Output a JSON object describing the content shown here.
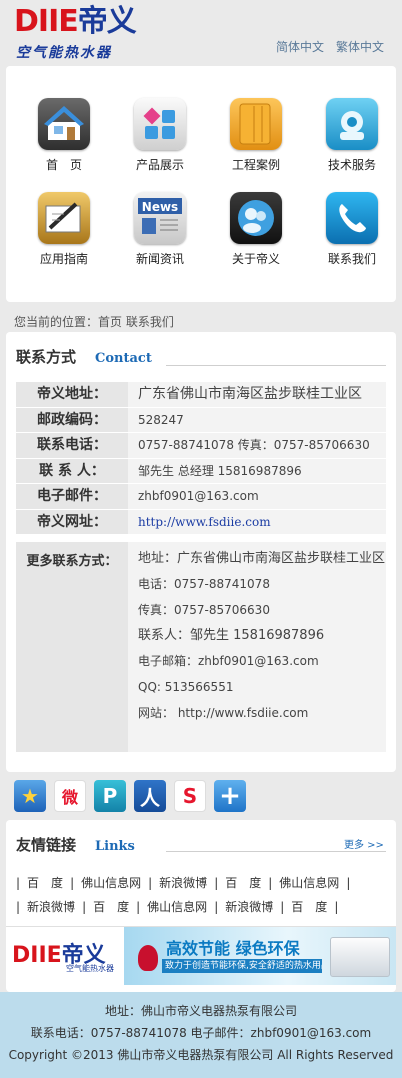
{
  "header": {
    "logo_text_latin": "DIIE",
    "logo_text_cn": "帝义",
    "logo_slogan": "空气能热水器",
    "lang_simplified": "简体中文",
    "lang_traditional": "繁体中文"
  },
  "menu": [
    {
      "label": "首　页",
      "icon": "home-icon"
    },
    {
      "label": "产品展示",
      "icon": "products-icon"
    },
    {
      "label": "工程案例",
      "icon": "folders-icon"
    },
    {
      "label": "技术服务",
      "icon": "service-icon"
    },
    {
      "label": "应用指南",
      "icon": "guide-icon"
    },
    {
      "label": "新闻资讯",
      "icon": "news-icon"
    },
    {
      "label": "关于帝义",
      "icon": "about-icon"
    },
    {
      "label": "联系我们",
      "icon": "phone-icon"
    }
  ],
  "breadcrumb": "您当前的位置：首页  联系我们",
  "contact": {
    "title": "联系方式",
    "title_en": "Contact",
    "rows": [
      {
        "label": "帝义地址：",
        "value": "广东省佛山市南海区盐步联桂工业区"
      },
      {
        "label": "邮政编码：",
        "value": "528247"
      },
      {
        "label": "联系电话：",
        "value": "0757-88741078  传真：0757-85706630"
      },
      {
        "label": "联 系 人：",
        "value": "邹先生 总经理  15816987896"
      },
      {
        "label": "电子邮件：",
        "value": "zhbf0901@163.com"
      },
      {
        "label": "帝义网址：",
        "value": "http://www.fsdiie.com"
      }
    ],
    "more_label": "更多联系方式：",
    "more_lines": [
      "地址：广东省佛山市南海区盐步联桂工业区",
      "电话：0757-88741078",
      "传真：0757-85706630",
      "联系人：邹先生      15816987896",
      "电子邮箱：zhbf0901@163.com",
      "QQ: 513566551",
      "网站：    http://www.fsdiie.com"
    ]
  },
  "share": [
    {
      "icon": "qzone-icon",
      "glyph": "★"
    },
    {
      "icon": "weibo-icon",
      "glyph": "微"
    },
    {
      "icon": "tencent-weibo-icon",
      "glyph": "P"
    },
    {
      "icon": "renren-icon",
      "glyph": "人"
    },
    {
      "icon": "sohu-icon",
      "glyph": "S"
    },
    {
      "icon": "more-share-icon",
      "glyph": "+"
    }
  ],
  "links": {
    "title": "友情链接",
    "title_en": "Links",
    "more": "更多 >>",
    "row1": [
      "百　度",
      "佛山信息网",
      "新浪微博",
      "百　度",
      "佛山信息网"
    ],
    "row2": [
      "新浪微博",
      "百　度",
      "佛山信息网",
      "新浪微博",
      "百　度"
    ]
  },
  "banner": {
    "logo_latin": "DIIE",
    "logo_cn": "帝义",
    "logo_sub": "空气能热水器",
    "headline": "高效节能 绿色环保",
    "subline": "致力于创造节能环保,安全舒适的热水用品"
  },
  "footer": {
    "address": "地址：佛山市帝义电器热泵有限公司",
    "phone_email": "联系电话：0757-88741078     电子邮件：zhbf0901@163.com",
    "copyright": "Copyright ©2013 佛山市帝义电器热泵有限公司  All Rights Reserved"
  }
}
